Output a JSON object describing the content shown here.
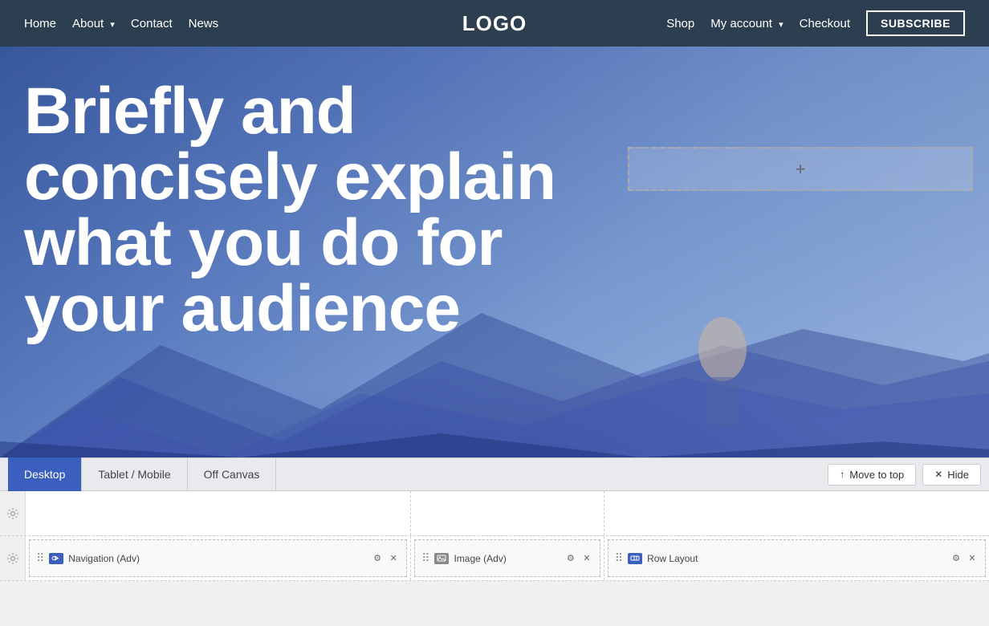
{
  "header": {
    "logo": "LOGO",
    "nav_left": [
      {
        "label": "Home",
        "has_dropdown": false
      },
      {
        "label": "About",
        "has_dropdown": true
      },
      {
        "label": "Contact",
        "has_dropdown": false
      },
      {
        "label": "News",
        "has_dropdown": false
      }
    ],
    "nav_right": [
      {
        "label": "Shop",
        "has_dropdown": false
      },
      {
        "label": "My account",
        "has_dropdown": true
      },
      {
        "label": "Checkout",
        "has_dropdown": false
      }
    ],
    "subscribe_label": "SUBSCRIBE"
  },
  "hero": {
    "headline": "Briefly and concisely explain what you do for your audience",
    "add_widget_plus": "+"
  },
  "toolbar": {
    "tabs": [
      {
        "label": "Desktop",
        "active": true
      },
      {
        "label": "Tablet / Mobile",
        "active": false
      },
      {
        "label": "Off Canvas",
        "active": false
      }
    ],
    "move_to_top": "Move to top",
    "hide": "Hide"
  },
  "builder": {
    "row1": {
      "columns": [
        "col1",
        "col2",
        "col3"
      ]
    },
    "row2": {
      "widgets": [
        {
          "label": "Navigation (Adv)",
          "type": "nav",
          "icon": "nav"
        },
        {
          "label": "Image (Adv)",
          "type": "image",
          "icon": "img"
        },
        {
          "label": "Row Layout",
          "type": "row",
          "icon": "row"
        }
      ]
    }
  },
  "icons": {
    "gear": "⚙",
    "close": "✕",
    "drag": "⠿",
    "arrow_up": "↑",
    "chevron_down": "▾"
  }
}
